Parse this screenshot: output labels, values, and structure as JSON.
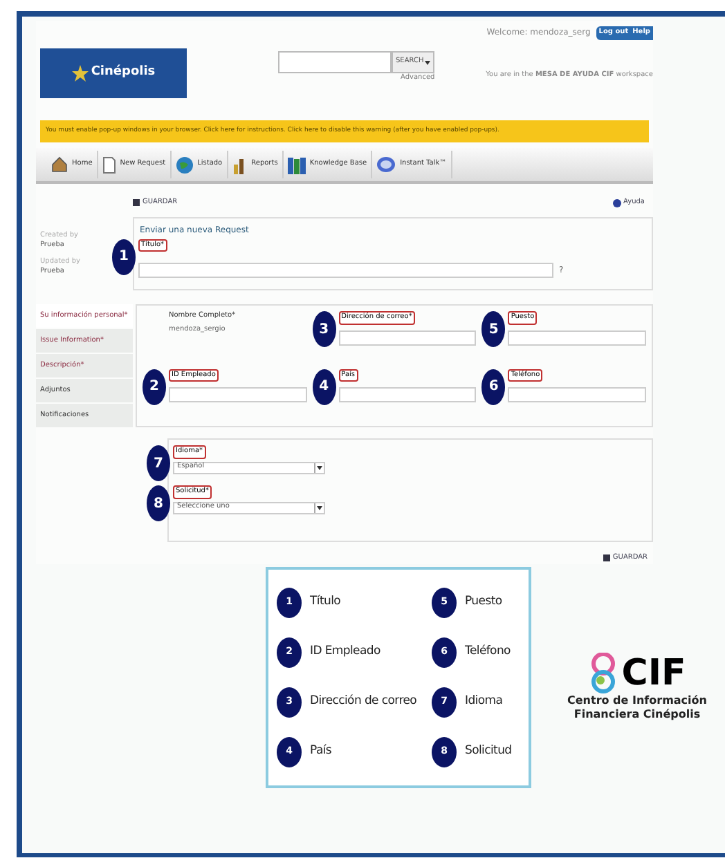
{
  "header": {
    "logo": "Cinépolis",
    "welcome": "Welcome: mendoza_serg",
    "buttons": [
      "Log out",
      "Help"
    ],
    "search_button": "SEARCH",
    "advanced": "Advanced",
    "workspace": "You are in the **MESA DE AYUDA CIF** workspace"
  },
  "banner": "You must enable pop-up windows in your browser. Click here for instructions. Click here to disable this warning (after you have enabled pop-ups).",
  "nav": [
    {
      "label": "Home",
      "kind": "home"
    },
    {
      "label": "New Request",
      "kind": "page"
    },
    {
      "label": "Listado",
      "kind": "globe"
    },
    {
      "label": "Reports",
      "kind": "reports"
    },
    {
      "label": "Knowledge Base",
      "kind": "books"
    },
    {
      "label": "Instant Talk™",
      "kind": "chat"
    }
  ],
  "toolbar": {
    "save": "GUARDAR",
    "help": "Ayuda"
  },
  "meta": [
    "Created by",
    "Prueba",
    "Updated by",
    "Prueba"
  ],
  "request": {
    "heading": "Enviar una nueva Request",
    "label": "Título*",
    "callout": "1",
    "hint": "?"
  },
  "side_tabs": [
    {
      "label": "Su información personal*",
      "selected": true,
      "required": true
    },
    {
      "label": "Issue Information*",
      "selected": false,
      "required": true
    },
    {
      "label": "Descripción*",
      "selected": false,
      "required": true
    },
    {
      "label": "Adjuntos",
      "selected": false,
      "required": false
    },
    {
      "label": "Notificaciones",
      "selected": false,
      "required": false
    }
  ],
  "personal_fields": [
    {
      "label": "Nombre Completo*",
      "kind": "text",
      "value": "mendoza_sergio"
    },
    {
      "label": "Dirección de correo*",
      "kind": "input",
      "callout": "3"
    },
    {
      "label": "Puesto",
      "kind": "input",
      "callout": "5"
    },
    {
      "label": "ID Empleado",
      "kind": "input",
      "callout": "2"
    },
    {
      "label": "País",
      "kind": "input",
      "callout": "4"
    },
    {
      "label": "Teléfono",
      "kind": "input",
      "callout": "6"
    }
  ],
  "selects": [
    {
      "label": "Idioma*",
      "callout": "7",
      "value": "Español"
    },
    {
      "label": "Solicitud*",
      "callout": "8",
      "value": "Seleccione uno"
    }
  ],
  "bottom_save": "GUARDAR",
  "legend": [
    {
      "number": "1",
      "label": "Título"
    },
    {
      "number": "2",
      "label": "ID Empleado"
    },
    {
      "number": "3",
      "label": "Dirección de correo"
    },
    {
      "number": "4",
      "label": "País"
    },
    {
      "number": "5",
      "label": "Puesto"
    },
    {
      "number": "6",
      "label": "Teléfono"
    },
    {
      "number": "7",
      "label": "Idioma"
    },
    {
      "number": "8",
      "label": "Solicitud"
    }
  ],
  "brand": {
    "name": "CIF",
    "line1": "Centro de Información",
    "line2": "Financiera Cinépolis"
  }
}
